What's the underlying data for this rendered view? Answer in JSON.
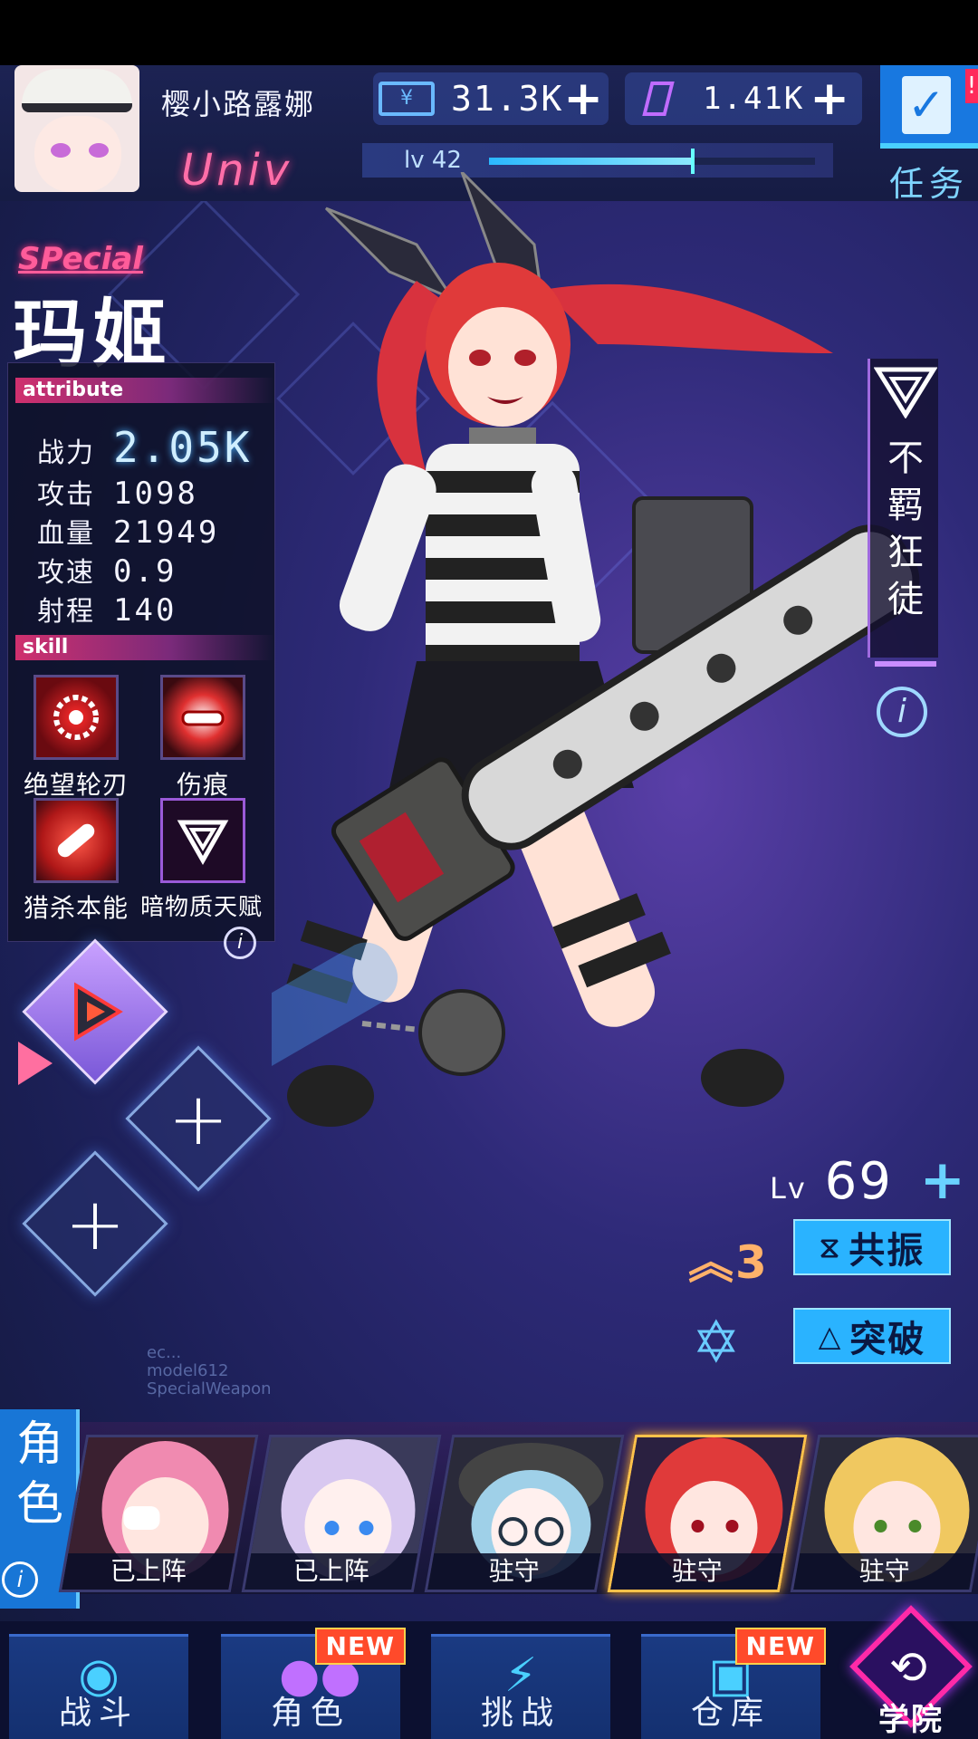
{
  "player": {
    "name": "樱小路露娜",
    "guild": "Univ",
    "level_label": "lv 42",
    "level_progress": 0.62
  },
  "resources": {
    "gold": "31.3K",
    "crystal": "1.41K",
    "gold_icon": "¥"
  },
  "task": {
    "label": "任务",
    "badge": "!"
  },
  "character": {
    "rarity": "SPecial",
    "name": "玛姬",
    "faction": "不羁狂徒",
    "level_prefix": "Lv",
    "level": "69",
    "awaken": "3",
    "resonate_label": "共振",
    "breakthrough_label": "突破"
  },
  "attribute": {
    "header": "attribute",
    "power_label": "战力",
    "power": "2.05K",
    "attack_label": "攻击",
    "attack": "1098",
    "hp_label": "血量",
    "hp": "21949",
    "speed_label": "攻速",
    "speed": "0.9",
    "range_label": "射程",
    "range": "140"
  },
  "skill": {
    "header": "skill",
    "items": [
      {
        "name": "绝望轮刃",
        "icon": "saw-blade-icon"
      },
      {
        "name": "伤痕",
        "icon": "chainsaw-burst-icon"
      },
      {
        "name": "猎杀本能",
        "icon": "chainsaw-icon"
      },
      {
        "name": "暗物质天赋",
        "icon": "dark-triangle-icon"
      }
    ]
  },
  "watermark": {
    "line1": "ec...",
    "line2": "model612",
    "line3": "SpecialWeapon"
  },
  "roster": {
    "tab_label": "角色",
    "cards": [
      {
        "status": "已上阵",
        "hair": "#f08ab0"
      },
      {
        "status": "已上阵",
        "hair": "#d8c8f0"
      },
      {
        "status": "驻守",
        "hair": "#9fd0e8"
      },
      {
        "status": "驻守",
        "hair": "#e03a3a"
      },
      {
        "status": "驻守",
        "hair": "#f0c860"
      }
    ]
  },
  "nav": {
    "battle": "战斗",
    "character": "角色",
    "challenge": "挑战",
    "warehouse": "仓库",
    "academy": "学院",
    "new_badge": "NEW"
  },
  "colors": {
    "accent_pink": "#ff5c9a",
    "accent_blue": "#2ab3ff",
    "background": "#2e2a78"
  }
}
